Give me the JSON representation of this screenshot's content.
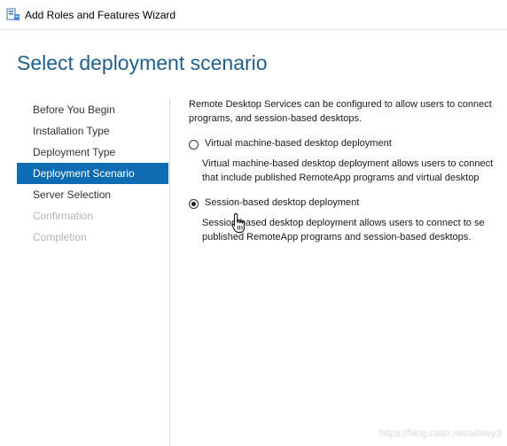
{
  "window": {
    "title": "Add Roles and Features Wizard",
    "icon": "server-manager-icon"
  },
  "page": {
    "title": "Select deployment scenario"
  },
  "nav": {
    "items": [
      {
        "label": "Before You Begin",
        "state": "done"
      },
      {
        "label": "Installation Type",
        "state": "done"
      },
      {
        "label": "Deployment Type",
        "state": "done"
      },
      {
        "label": "Deployment Scenario",
        "state": "active"
      },
      {
        "label": "Server Selection",
        "state": "future"
      },
      {
        "label": "Confirmation",
        "state": "disabled"
      },
      {
        "label": "Completion",
        "state": "disabled"
      }
    ]
  },
  "content": {
    "intro_line1": "Remote Desktop Services can be configured to allow users to connect",
    "intro_line2": "programs, and session-based desktops.",
    "options": [
      {
        "label": "Virtual machine-based desktop deployment",
        "selected": false,
        "desc_line1": "Virtual machine-based desktop deployment allows users to connect",
        "desc_line2": "that include published RemoteApp programs and virtual desktop"
      },
      {
        "label": "Session-based desktop deployment",
        "selected": true,
        "desc_line1": "Session-based desktop deployment allows users to connect to se",
        "desc_line2": "published RemoteApp programs and session-based desktops."
      }
    ]
  },
  "watermark": "https://blog.csdn.net/allway2",
  "colors": {
    "accent": "#0e6cb1",
    "title": "#1f5f8b",
    "disabled_text": "#b4b4b4"
  }
}
